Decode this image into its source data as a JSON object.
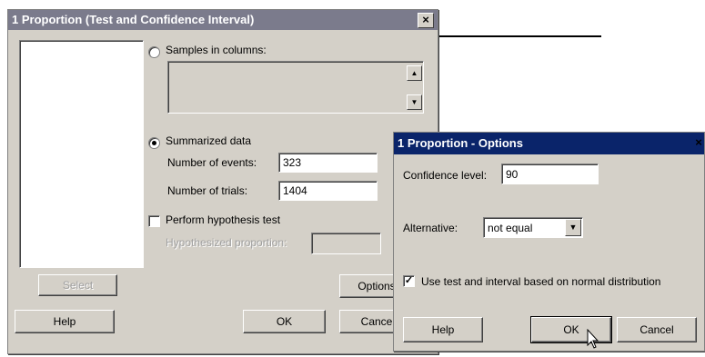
{
  "main_dialog": {
    "title": "1 Proportion (Test and Confidence Interval)",
    "close_glyph": "×",
    "samples_in_columns_label": "Samples in columns:",
    "summarized_data_label": "Summarized data",
    "number_of_events_label": "Number of events:",
    "number_of_events_value": "323",
    "number_of_trials_label": "Number of trials:",
    "number_of_trials_value": "1404",
    "perform_test_label": "Perform hypothesis test",
    "hypothesized_proportion_label": "Hypothesized proportion:",
    "hypothesized_proportion_value": "",
    "select_label": "Select",
    "help_label": "Help",
    "ok_label": "OK",
    "options_label": "Options",
    "cancel_label": "Cance",
    "selected_source": "summarized_data",
    "perform_test_checked": false
  },
  "options_dialog": {
    "title": "1 Proportion - Options",
    "close_glyph": "×",
    "confidence_level_label": "Confidence level:",
    "confidence_level_value": "90",
    "alternative_label": "Alternative:",
    "alternative_value": "not equal",
    "normal_dist_label": "Use test and interval based on normal distribution",
    "normal_dist_checked": true,
    "check_glyph": "✓",
    "help_label": "Help",
    "ok_label": "OK",
    "cancel_label": "Cancel"
  },
  "icons": {
    "up_arrow": "▲",
    "down_arrow": "▼",
    "dropdown_arrow": "▼"
  },
  "colors": {
    "title_bar": "#7b7b8c",
    "options_title_bar": "#0a246a",
    "dialog_face": "#d4d0c8"
  }
}
